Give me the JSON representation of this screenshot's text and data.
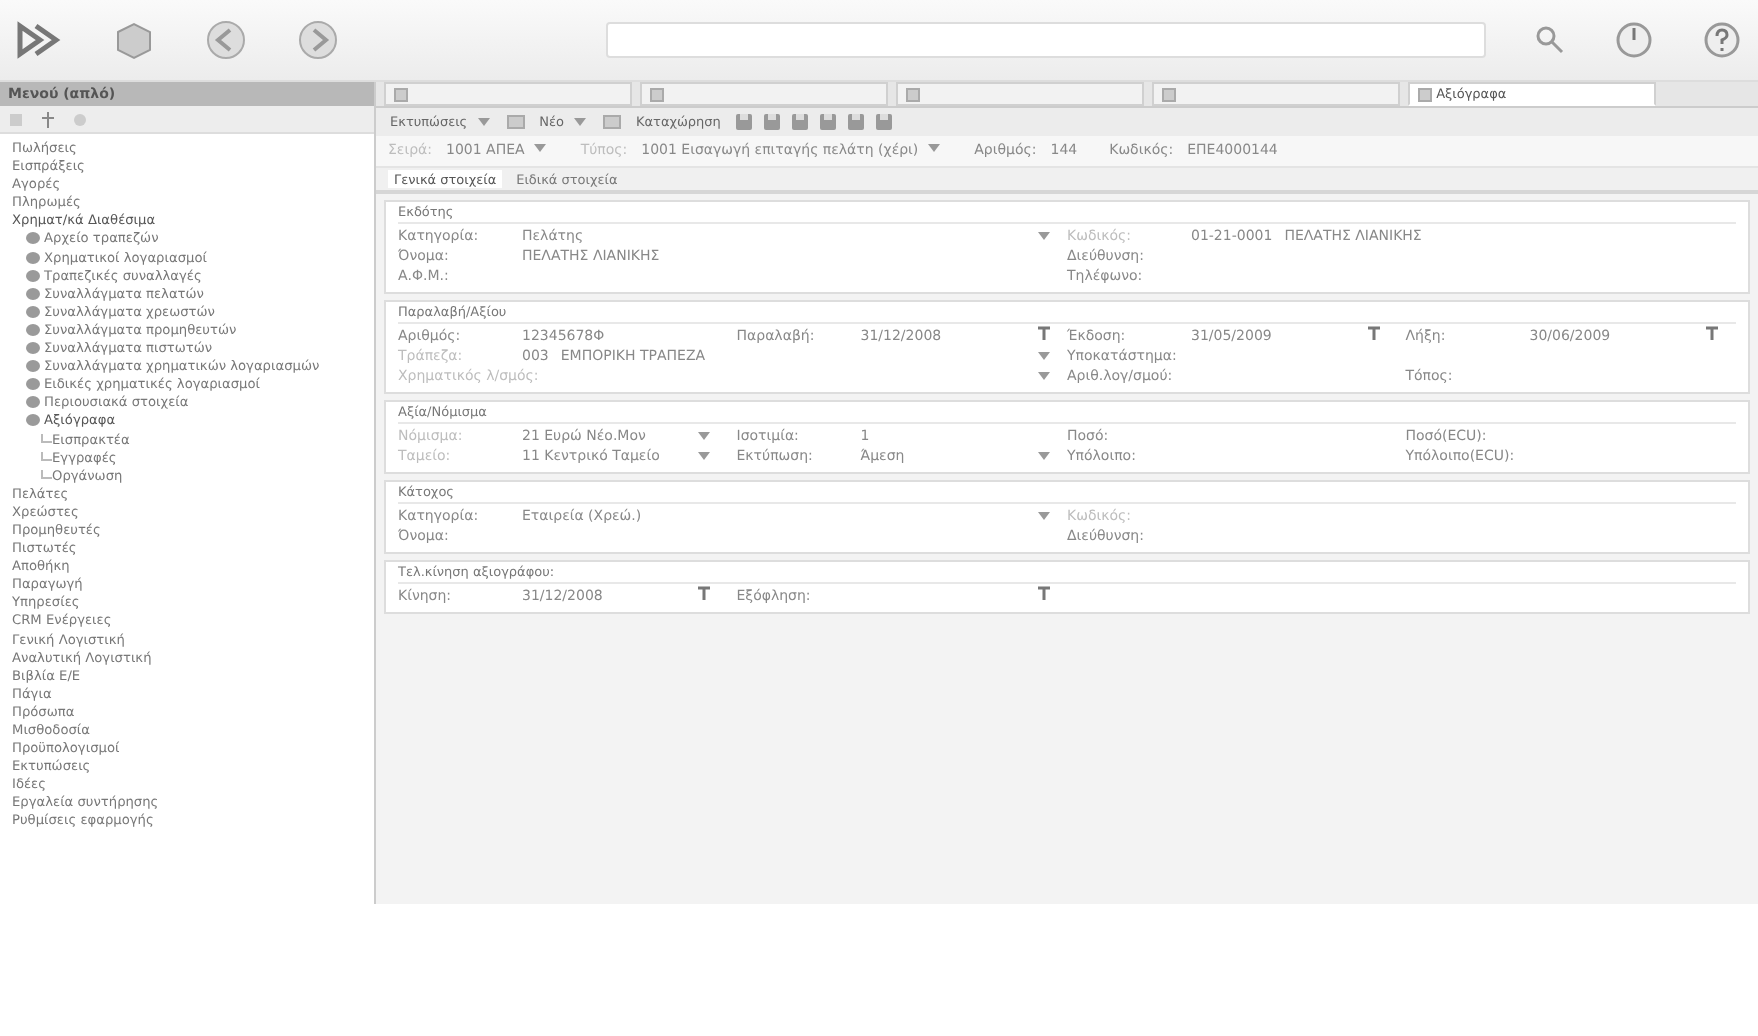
{
  "sidebar": {
    "title": "Μενού (απλό)",
    "items": [
      {
        "label": "Πωλήσεις",
        "expanded": false
      },
      {
        "label": "Εισπράξεις",
        "expanded": false
      },
      {
        "label": "Αγορές",
        "expanded": false
      },
      {
        "label": "Πληρωμές",
        "expanded": false
      },
      {
        "label": "Χρηματ/κά Διαθέσιμα",
        "expanded": true,
        "children": [
          {
            "label": "Αρχείο τραπεζών",
            "kind": "folder"
          },
          {
            "label": "Χρηματικοί λογαριασμοί",
            "kind": "folder"
          },
          {
            "label": "Τραπεζικές συναλλαγές",
            "kind": "folder"
          },
          {
            "label": "Συναλλάγματα πελατών",
            "kind": "folder"
          },
          {
            "label": "Συναλλάγματα χρεωστών",
            "kind": "folder"
          },
          {
            "label": "Συναλλάγματα προμηθευτών",
            "kind": "folder"
          },
          {
            "label": "Συναλλάγματα πιστωτών",
            "kind": "folder"
          },
          {
            "label": "Συναλλάγματα χρηματικών λογαριασμών",
            "kind": "folder"
          },
          {
            "label": "Ειδικές χρηματικές λογαριασμοί",
            "kind": "folder"
          },
          {
            "label": "Περιουσιακά στοιχεία",
            "kind": "folder"
          },
          {
            "label": "Αξιόγραφα",
            "kind": "folder",
            "expanded": true,
            "children": [
              {
                "label": "Εισπρακτέα",
                "kind": "leaf"
              },
              {
                "label": "Εγγραφές",
                "kind": "leaf"
              },
              {
                "label": "Οργάνωση",
                "kind": "leaf"
              }
            ]
          }
        ]
      },
      {
        "label": "Πελάτες",
        "expanded": false
      },
      {
        "label": "Χρεώστες",
        "expanded": false
      },
      {
        "label": "Προμηθευτές",
        "expanded": false
      },
      {
        "label": "Πιστωτές",
        "expanded": false
      },
      {
        "label": "Αποθήκη",
        "expanded": false
      },
      {
        "label": "Παραγωγή",
        "expanded": false
      },
      {
        "label": "Υπηρεσίες",
        "expanded": false
      },
      {
        "label": "CRM Ενέργειες",
        "expanded": false
      },
      {
        "label": "Γενική Λογιστική",
        "expanded": false
      },
      {
        "label": "Αναλυτική Λογιστική",
        "expanded": false
      },
      {
        "label": "Βιβλία Ε/Ε",
        "expanded": false
      },
      {
        "label": "Πάγια",
        "expanded": false
      },
      {
        "label": "Πρόσωπα",
        "expanded": false
      },
      {
        "label": "Μισθοδοσία",
        "expanded": false
      },
      {
        "label": "Προϋπολογισμοί",
        "expanded": false
      },
      {
        "label": "Εκτυπώσεις",
        "expanded": false
      },
      {
        "label": "Ιδέες",
        "expanded": false
      },
      {
        "label": "Εργαλεία συντήρησης",
        "expanded": false
      },
      {
        "label": "Ρυθμίσεις εφαρμογής",
        "expanded": false
      }
    ]
  },
  "tabs": [
    {
      "selected": false
    },
    {
      "selected": false
    },
    {
      "selected": false
    },
    {
      "selected": false
    },
    {
      "label": "Αξιόγραφα",
      "selected": true
    }
  ],
  "toolbar": [
    {
      "label": "Εκτυπώσεις",
      "kind": "dropdown"
    },
    {
      "label": "Νέο",
      "kind": "dropdown"
    },
    {
      "label": "Καταχώρηση",
      "kind": "button"
    }
  ],
  "header": [
    {
      "label": "Σειρά:",
      "value": "1001 ΑΠΕΑ",
      "kind": "select",
      "muted": true
    },
    {
      "label": "Τύπος:",
      "value": "1001 Εισαγωγή επιταγής πελάτη (χέρι)",
      "kind": "select",
      "muted": true
    },
    {
      "label": "Αριθμός:",
      "value": "144",
      "kind": "text",
      "muted": false
    },
    {
      "label": "Κωδικός:",
      "value": "ΕΠΕ4000144",
      "kind": "text",
      "muted": false
    }
  ],
  "subtabs": [
    {
      "label": "Γενικά στοιχεία",
      "selected": true
    },
    {
      "label": "Ειδικά στοιχεία",
      "selected": false
    }
  ],
  "sections": [
    {
      "title": "Εκδότης",
      "rows": [
        {
          "left": [
            {
              "label": "Κατηγορία:",
              "value": "Πελάτης",
              "kind": "select",
              "muted": false
            }
          ],
          "right": [
            {
              "label": "Κωδικός:",
              "value": "01-21-0001",
              "extra": "ΠΕΛΑΤΗΣ ΛΙΑΝΙΚΗΣ",
              "kind": "text",
              "muted": true
            }
          ]
        },
        {
          "left": [
            {
              "label": "Όνομα:",
              "value": "ΠΕΛΑΤΗΣ ΛΙΑΝΙΚΗΣ",
              "kind": "text",
              "muted": false
            }
          ],
          "right": [
            {
              "label": "Διεύθυνση:",
              "kind": "text",
              "muted": false
            }
          ]
        },
        {
          "left": [
            {
              "label": "Α.Φ.Μ.:",
              "kind": "text",
              "muted": false
            }
          ],
          "right": [
            {
              "label": "Τηλέφωνο:",
              "kind": "text",
              "muted": false
            }
          ]
        }
      ]
    },
    {
      "title": "Παραλαβή/Αξίου",
      "rows": [
        {
          "left": [
            {
              "label": "Αριθμός:",
              "value": "12345678Φ",
              "kind": "text",
              "muted": false
            },
            {
              "label": "Παραλαβή:",
              "value": "31/12/2008",
              "kind": "date",
              "muted": false
            }
          ],
          "right": [
            {
              "label": "Έκδοση:",
              "value": "31/05/2009",
              "kind": "date",
              "muted": false
            },
            {
              "label": "Λήξη:",
              "value": "30/06/2009",
              "kind": "date",
              "muted": false
            }
          ]
        },
        {
          "left": [
            {
              "label": "Τράπεζα:",
              "value": "003",
              "extra": "ΕΜΠΟΡΙΚΗ ΤΡΑΠΕΖΑ",
              "kind": "select",
              "muted": true
            }
          ],
          "right": [
            {
              "label": "Υποκατάστημα:",
              "kind": "text",
              "muted": false
            }
          ]
        },
        {
          "left": [
            {
              "label": "Χρηματικός λ/σμός:",
              "kind": "select",
              "muted": true
            }
          ],
          "right": [
            {
              "label": "Αριθ.λογ/σμού:",
              "kind": "text",
              "muted": false
            },
            {
              "label": "Τόπος:",
              "kind": "text",
              "muted": false
            }
          ]
        }
      ]
    },
    {
      "title": "Αξία/Νόμισμα",
      "rows": [
        {
          "left": [
            {
              "label": "Νόμισμα:",
              "value": "21 Ευρώ Νέο.Μον",
              "kind": "select",
              "muted": true
            },
            {
              "label": "Ισοτιμία:",
              "value": "1",
              "kind": "text",
              "muted": false
            }
          ],
          "right": [
            {
              "label": "Ποσό:",
              "kind": "text",
              "muted": false
            },
            {
              "label": "Ποσό(ECU):",
              "kind": "text",
              "muted": false
            }
          ]
        },
        {
          "left": [
            {
              "label": "Ταμείο:",
              "value": "11 Κεντρικό Ταμείο",
              "kind": "select",
              "muted": true
            },
            {
              "label": "Εκτύπωση:",
              "value": "Άμεση",
              "kind": "select",
              "muted": false
            }
          ],
          "right": [
            {
              "label": "Υπόλοιπο:",
              "kind": "text",
              "muted": false
            },
            {
              "label": "Υπόλοιπο(ECU):",
              "kind": "text",
              "muted": false
            }
          ]
        }
      ]
    },
    {
      "title": "Κάτοχος",
      "rows": [
        {
          "left": [
            {
              "label": "Κατηγορία:",
              "value": "Εταιρεία (Χρεώ.)",
              "kind": "select",
              "muted": false
            }
          ],
          "right": [
            {
              "label": "Κωδικός:",
              "kind": "text",
              "muted": true
            }
          ]
        },
        {
          "left": [
            {
              "label": "Όνομα:",
              "kind": "text",
              "muted": false
            }
          ],
          "right": [
            {
              "label": "Διεύθυνση:",
              "kind": "text",
              "muted": false
            }
          ]
        }
      ]
    },
    {
      "title": "Τελ.κίνηση αξιογράφου:",
      "rows": [
        {
          "left": [
            {
              "label": "Κίνηση:",
              "value": "31/12/2008",
              "kind": "date",
              "muted": false
            },
            {
              "label": "Εξόφληση:",
              "kind": "date",
              "muted": false
            }
          ],
          "right": []
        }
      ]
    }
  ]
}
